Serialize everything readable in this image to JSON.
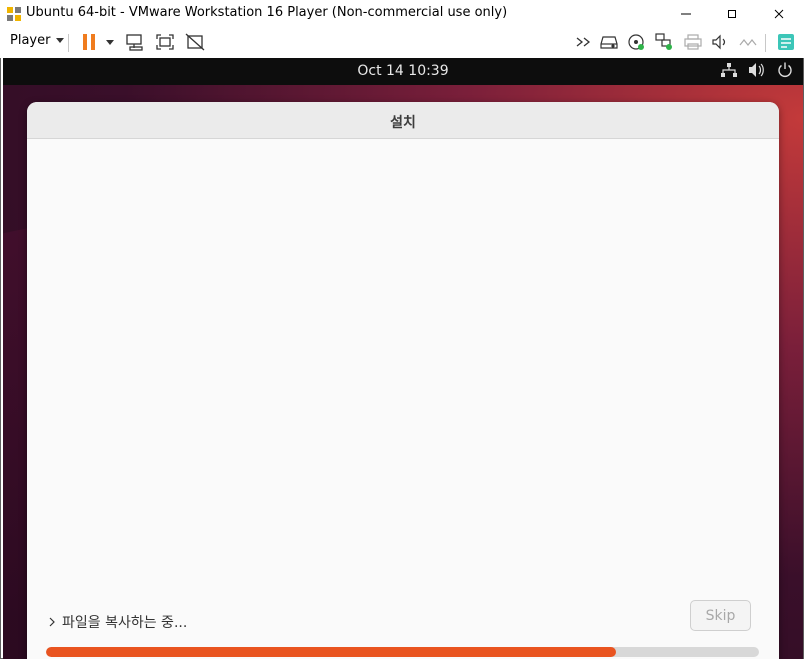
{
  "window": {
    "title": "Ubuntu 64-bit - VMware Workstation 16 Player (Non-commercial use only)",
    "controls": [
      "minimize-icon",
      "maximize-icon",
      "close-icon"
    ]
  },
  "toolbar": {
    "player_label": "Player",
    "left_icons": [
      "pause-icon",
      "dropdown-icon",
      "send-ctrl-alt-del-icon",
      "fullscreen-icon",
      "unity-icon"
    ],
    "right_icons": [
      "more-icon",
      "hard-disk-icon",
      "cd-dvd-icon",
      "network-adapter-icon",
      "printer-icon",
      "sound-card-icon",
      "usb-icon",
      "message-log-icon"
    ]
  },
  "guest": {
    "topbar": {
      "clock": "Oct 14  10:39",
      "tray_icons": [
        "network-icon",
        "volume-icon",
        "power-icon"
      ]
    },
    "installer": {
      "title": "설치",
      "status_text": "파일을 복사하는 중...",
      "skip_label": "Skip",
      "progress": 0.8
    }
  },
  "colors": {
    "accent": "#e95420",
    "pause": "#f07c1e"
  }
}
